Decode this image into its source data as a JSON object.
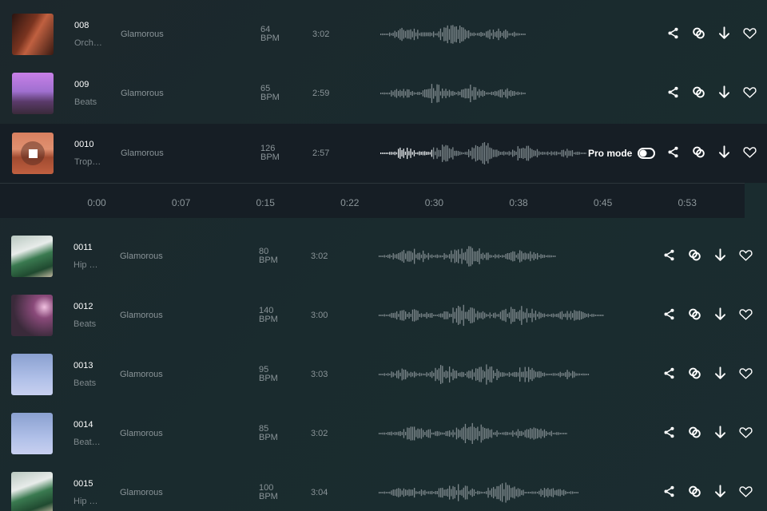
{
  "tracks": [
    {
      "id": "008",
      "genre": "Orch…",
      "artist": "Glamorous",
      "bpm": "64",
      "bpm_unit": "BPM",
      "duration": "3:02",
      "thumb": "violin"
    },
    {
      "id": "009",
      "genre": "Beats",
      "artist": "Glamorous",
      "bpm": "65",
      "bpm_unit": "BPM",
      "duration": "2:59",
      "thumb": "purple-mountains"
    },
    {
      "id": "0010",
      "genre": "Trop…",
      "artist": "Glamorous",
      "bpm": "126",
      "bpm_unit": "BPM",
      "duration": "2:57",
      "thumb": "sunset-sea",
      "playing": true,
      "progress": 0.25
    },
    {
      "id": "0011",
      "genre": "Hip …",
      "artist": "Glamorous",
      "bpm": "80",
      "bpm_unit": "BPM",
      "duration": "3:02",
      "thumb": "green-car"
    },
    {
      "id": "0012",
      "genre": "Beats",
      "artist": "Glamorous",
      "bpm": "140",
      "bpm_unit": "BPM",
      "duration": "3:00",
      "thumb": "foggy-night"
    },
    {
      "id": "0013",
      "genre": "Beats",
      "artist": "Glamorous",
      "bpm": "95",
      "bpm_unit": "BPM",
      "duration": "3:03",
      "thumb": "snow-figure"
    },
    {
      "id": "0014",
      "genre": "Beat…",
      "artist": "Glamorous",
      "bpm": "85",
      "bpm_unit": "BPM",
      "duration": "3:02",
      "thumb": "snow-figure"
    },
    {
      "id": "0015",
      "genre": "Hip …",
      "artist": "Glamorous",
      "bpm": "100",
      "bpm_unit": "BPM",
      "duration": "3:04",
      "thumb": "green-car"
    }
  ],
  "pro_mode": {
    "label": "Pro mode",
    "enabled": false
  },
  "timeline": [
    "0:00",
    "0:07",
    "0:15",
    "0:22",
    "0:30",
    "0:38",
    "0:45",
    "0:53"
  ],
  "icons": [
    "share-icon",
    "link-icon",
    "download-icon",
    "heart-icon"
  ]
}
